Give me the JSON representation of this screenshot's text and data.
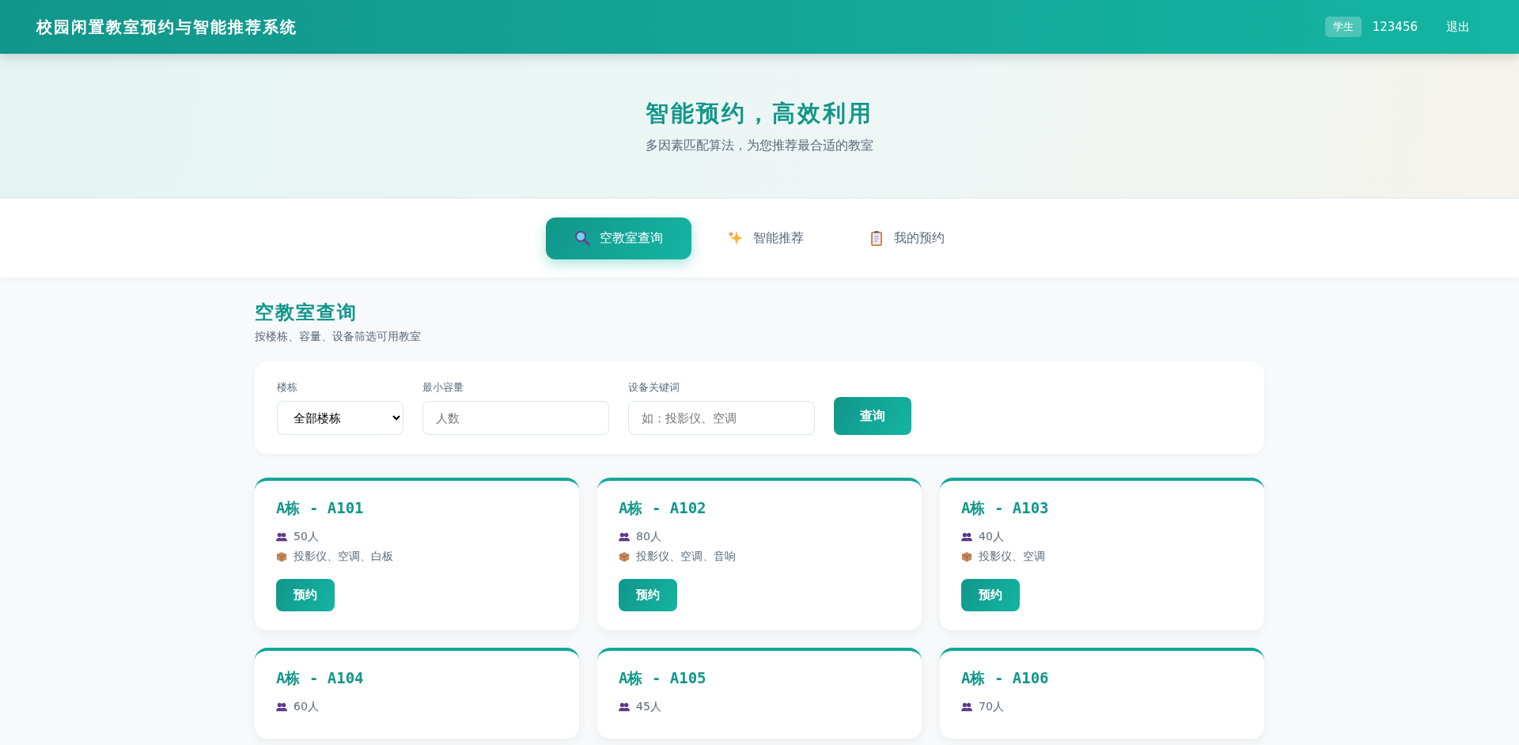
{
  "header": {
    "title": "校园闲置教室预约与智能推荐系统",
    "role_badge": "学生",
    "username": "123456",
    "logout": "退出"
  },
  "hero": {
    "title": "智能预约，高效利用",
    "subtitle": "多因素匹配算法，为您推荐最合适的教室"
  },
  "tabs": [
    {
      "label": "空教室查询",
      "selected": true
    },
    {
      "label": "智能推荐",
      "selected": false
    },
    {
      "label": "我的预约",
      "selected": false
    }
  ],
  "section": {
    "title": "空教室查询",
    "subtitle": "按楼栋、容量、设备筛选可用教室"
  },
  "filters": [
    {
      "label": "楼栋",
      "kind": "select",
      "value": "全部楼栋"
    },
    {
      "label": "最小容量",
      "kind": "input",
      "placeholder": "人数"
    },
    {
      "label": "设备关键词",
      "kind": "input",
      "placeholder": "如：投影仪、空调"
    }
  ],
  "query_button": "查询",
  "rooms": [
    {
      "name": "A栋 - A101",
      "capacity": "50人",
      "equipment": "投影仪、空调、白板",
      "button": "预约"
    },
    {
      "name": "A栋 - A102",
      "capacity": "80人",
      "equipment": "投影仪、空调、音响",
      "button": "预约"
    },
    {
      "name": "A栋 - A103",
      "capacity": "40人",
      "equipment": "投影仪、空调",
      "button": "预约"
    },
    {
      "name": "A栋 - A104",
      "capacity": "60人"
    },
    {
      "name": "A栋 - A105",
      "capacity": "45人"
    },
    {
      "name": "A栋 - A106",
      "capacity": "70人"
    }
  ]
}
